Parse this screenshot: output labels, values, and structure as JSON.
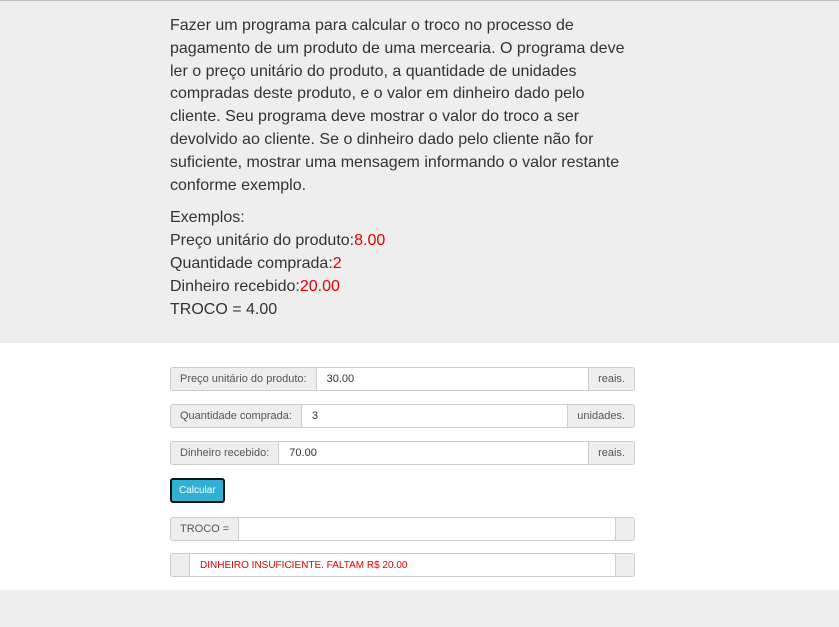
{
  "problem": {
    "description": "Fazer um programa para calcular o troco no processo de pagamento de um produto de uma mercearia. O programa deve ler o preço unitário do produto, a quantidade de unidades compradas deste produto, e o valor em dinheiro dado pelo cliente. Seu programa deve mostrar o valor do troco a ser devolvido ao cliente. Se o dinheiro dado pelo cliente não for suficiente, mostrar uma mensagem informando o valor restante conforme exemplo.",
    "examples_heading": "Exemplos:",
    "examples": [
      {
        "label": "Preço unitário do produto:",
        "value": "8.00"
      },
      {
        "label": "Quantidade comprada:",
        "value": "2"
      },
      {
        "label": "Dinheiro recebido:",
        "value": "20.00"
      }
    ],
    "result_line": "TROCO = 4.00"
  },
  "form": {
    "price": {
      "label": "Preço unitário do produto:",
      "value": "30.00",
      "suffix": "reais."
    },
    "quantity": {
      "label": "Quantidade comprada:",
      "value": "3",
      "suffix": "unidades."
    },
    "money": {
      "label": "Dinheiro recebido:",
      "value": "70.00",
      "suffix": "reais."
    },
    "button_label": "Calcular",
    "change_label": "TROCO =",
    "change_value": "",
    "message": "DINHEIRO INSUFICIENTE. FALTAM R$ 20.00"
  },
  "colors": {
    "highlight": "#e00000",
    "button": "#31b0d5",
    "panel": "#eeeeee"
  }
}
